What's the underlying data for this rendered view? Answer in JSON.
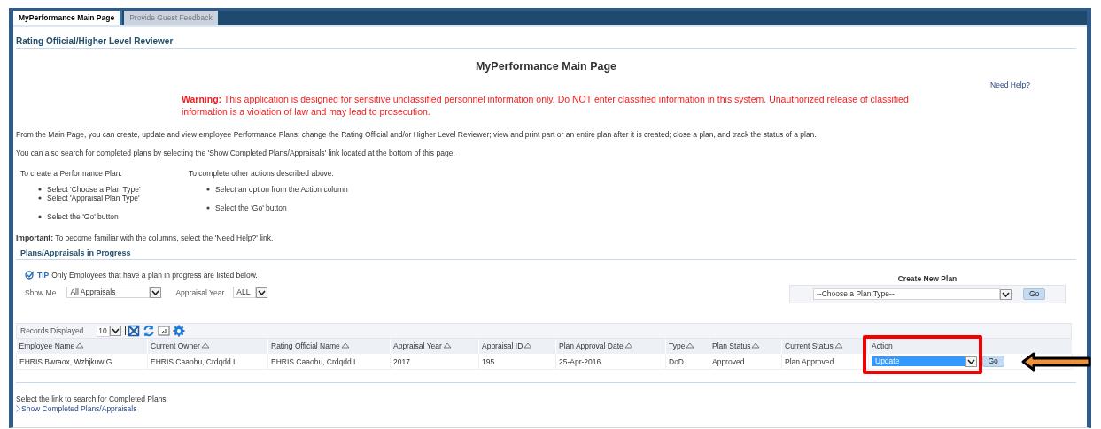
{
  "tabs": [
    {
      "label": "MyPerformance Main Page",
      "selected": true
    },
    {
      "label": "Provide Guest Feedback",
      "selected": false
    }
  ],
  "section_title": "Rating Official/Higher Level Reviewer",
  "page_title": "MyPerformance Main Page",
  "help_link": "Need Help?",
  "warning": "**Warning:** This application is designed for sensitive unclassified personnel information only. Do NOT enter classified information in this system. Unauthorized release of classified information is a violation of law and may lead to prosecution.",
  "intro": [
    "From the Main Page, you can create, update and view employee Performance Plans; change the Rating Official and/or Higher Level Reviewer; view and print part or an entire plan after it is created; close a plan, and track the status of a plan.",
    "You can also search for completed plans by selecting the 'Show Completed Plans/Appraisals' link located at the bottom of this page."
  ],
  "instructions": [
    {
      "heading": "To create a Performance Plan:",
      "groups": [
        [
          "Select 'Choose a Plan Type'",
          "Select 'Appraisal Plan Type'"
        ],
        [
          "Select the 'Go' button"
        ]
      ]
    },
    {
      "heading": "To complete other actions described above:",
      "groups": [
        [
          "Select an option from the Action column"
        ],
        [
          "Select the 'Go' button"
        ]
      ]
    }
  ],
  "important": "**Important:** To become familiar with the columns, select the 'Need Help?' link.",
  "plans_title": "Plans/Appraisals in Progress",
  "tip": {
    "label": "TIP",
    "text": "Only Employees that have a plan in progress are listed below."
  },
  "filters": [
    {
      "label": "Show Me",
      "value": "All Appraisals"
    },
    {
      "label": "Appraisal Year",
      "value": "ALL"
    }
  ],
  "create_new_plan": {
    "title": "Create New Plan",
    "value": "--Choose a Plan Type--",
    "button": "Go"
  },
  "records": {
    "label": "Records Displayed",
    "value": "10"
  },
  "table": {
    "columns": [
      {
        "label": "Employee Name",
        "sortable": true
      },
      {
        "label": "Current Owner",
        "sortable": true
      },
      {
        "label": "Rating Official Name",
        "sortable": true
      },
      {
        "label": "Appraisal Year",
        "sortable": true
      },
      {
        "label": "Appraisal ID",
        "sortable": true
      },
      {
        "label": "Plan Approval Date",
        "sortable": true
      },
      {
        "label": "Type",
        "sortable": true
      },
      {
        "label": "Plan Status",
        "sortable": true
      },
      {
        "label": "Current Status",
        "sortable": true
      },
      {
        "label": "Action",
        "sortable": false
      }
    ],
    "rows": [
      {
        "cells": [
          "EHRIS Bwraox, Wzhjkuw G",
          "EHRIS Caaohu, Crdqdd I",
          "EHRIS Caaohu, Crdqdd I",
          "2017",
          "195",
          "25-Apr-2016",
          "DoD",
          "Approved",
          "Plan Approved"
        ],
        "action": "Update",
        "action_highlighted": true,
        "button": "Go"
      }
    ]
  },
  "footer_text": "Select the link to search for Completed Plans.",
  "footer_link": "Show Completed Plans/Appraisals"
}
